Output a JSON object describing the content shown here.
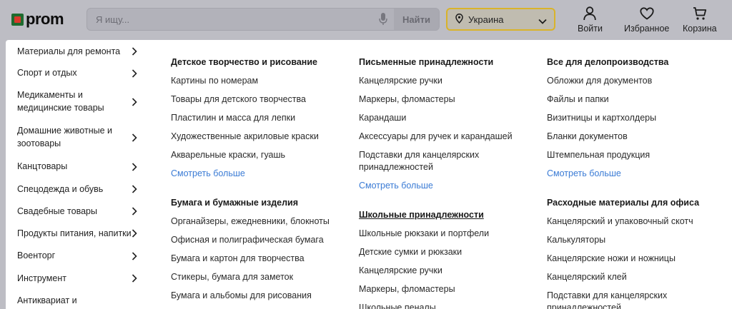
{
  "header": {
    "logo_text": "prom",
    "search_placeholder": "Я ищу...",
    "search_button": "Найти",
    "region": "Украина",
    "actions": {
      "login": "Войти",
      "favorites": "Избранное",
      "cart": "Корзина"
    }
  },
  "sidebar": {
    "items": [
      {
        "lines": [
          "Материалы для ремонта"
        ]
      },
      {
        "lines": [
          "Спорт и отдых"
        ]
      },
      {
        "lines": [
          "Медикаменты и",
          "медицинские товары"
        ]
      },
      {
        "lines": [
          "Домашние животные и",
          "зоотовары"
        ]
      },
      {
        "lines": [
          "Канцтовары"
        ]
      },
      {
        "lines": [
          "Спецодежда и обувь"
        ]
      },
      {
        "lines": [
          "Свадебные товары"
        ]
      },
      {
        "lines": [
          "Продукты питания, напитки"
        ]
      },
      {
        "lines": [
          "Военторг"
        ]
      },
      {
        "lines": [
          "Инструмент"
        ]
      },
      {
        "lines": [
          "Антиквариат и"
        ]
      }
    ]
  },
  "columns": [
    {
      "groups": [
        {
          "title": "Детское творчество и рисование",
          "links": [
            "Картины по номерам",
            "Товары для детского творчества",
            "Пластилин и масса для лепки",
            "Художественные акриловые краски",
            "Акварельные краски, гуашь"
          ],
          "more": "Смотреть больше"
        },
        {
          "title": "Бумага и бумажные изделия",
          "links": [
            "Органайзеры, ежедневники, блокноты",
            "Офисная и полиграфическая бумага",
            "Бумага и картон для творчества",
            "Стикеры, бумага для заметок",
            "Бумага и альбомы для рисования"
          ]
        }
      ]
    },
    {
      "groups": [
        {
          "title": "Письменные принадлежности",
          "links": [
            "Канцелярские ручки",
            "Маркеры, фломастеры",
            "Карандаши",
            "Аксессуары для ручек и карандашей",
            "Подставки для канцелярских",
            "принадлежностей"
          ],
          "more": "Смотреть больше"
        },
        {
          "title": "Школьные принадлежности",
          "links": [
            "Школьные рюкзаки и портфели",
            "Детские сумки и рюкзаки",
            "Канцелярские ручки",
            "Маркеры, фломастеры",
            "Школьные пеналы"
          ]
        }
      ]
    },
    {
      "groups": [
        {
          "title": "Все для делопроизводства",
          "links": [
            "Обложки для документов",
            "Файлы и папки",
            "Визитницы и картхолдеры",
            "Бланки документов",
            "Штемпельная продукция"
          ],
          "more": "Смотреть больше"
        },
        {
          "title": "Расходные материалы для офиса",
          "links": [
            "Канцелярский и упаковочный скотч",
            "Калькуляторы",
            "Канцелярские ножи и ножницы",
            "Канцелярский клей",
            "Подставки для канцелярских",
            "принадлежностей"
          ]
        }
      ]
    }
  ]
}
